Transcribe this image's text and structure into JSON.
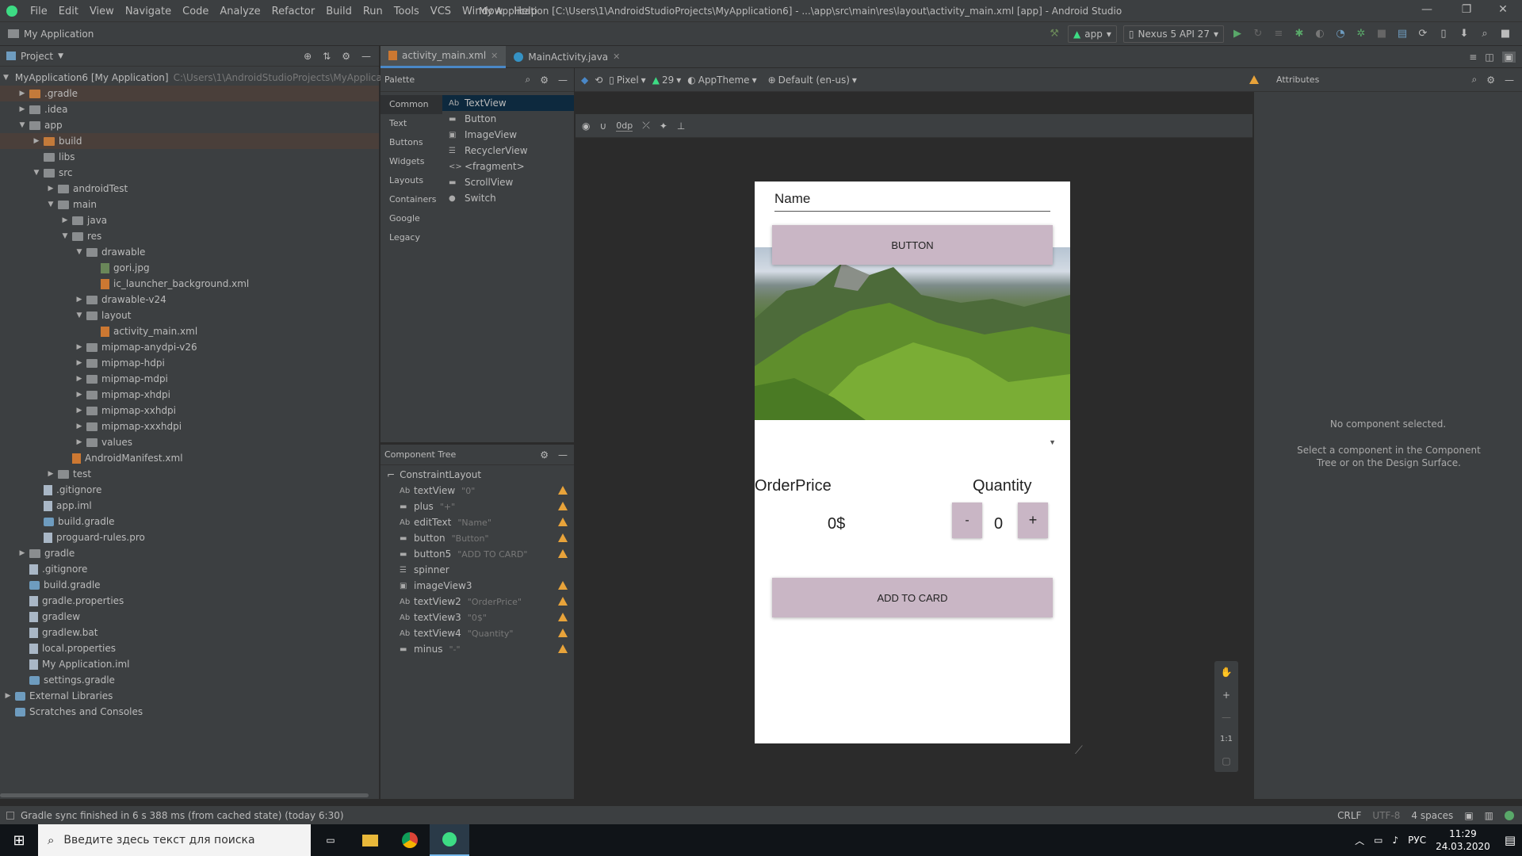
{
  "window": {
    "title": "My Application [C:\\Users\\1\\AndroidStudioProjects\\MyApplication6] - ...\\app\\src\\main\\res\\layout\\activity_main.xml [app] - Android Studio",
    "menu": [
      "File",
      "Edit",
      "View",
      "Navigate",
      "Code",
      "Analyze",
      "Refactor",
      "Build",
      "Run",
      "Tools",
      "VCS",
      "Window",
      "Help"
    ],
    "controls": {
      "minimize": "—",
      "maximize": "❐",
      "close": "✕"
    }
  },
  "navbar": {
    "breadcrumb": "My Application",
    "run_config": "app",
    "device": "Nexus 5 API 27"
  },
  "project": {
    "header": "Project",
    "root_label": "MyApplication6 [My Application]",
    "root_path": "C:\\Users\\1\\AndroidStudioProjects\\MyApplication",
    "items": [
      {
        "label": ".gradle",
        "level": 1,
        "arrow": "▶",
        "icon": "orange",
        "sel": true
      },
      {
        "label": ".idea",
        "level": 1,
        "arrow": "▶",
        "icon": "folder"
      },
      {
        "label": "app",
        "level": 1,
        "arrow": "▼",
        "icon": "folder"
      },
      {
        "label": "build",
        "level": 2,
        "arrow": "▶",
        "icon": "orange",
        "sel": true
      },
      {
        "label": "libs",
        "level": 2,
        "arrow": "",
        "icon": "folder"
      },
      {
        "label": "src",
        "level": 2,
        "arrow": "▼",
        "icon": "folder"
      },
      {
        "label": "androidTest",
        "level": 3,
        "arrow": "▶",
        "icon": "folder"
      },
      {
        "label": "main",
        "level": 3,
        "arrow": "▼",
        "icon": "folder"
      },
      {
        "label": "java",
        "level": 4,
        "arrow": "▶",
        "icon": "folder"
      },
      {
        "label": "res",
        "level": 4,
        "arrow": "▼",
        "icon": "folder"
      },
      {
        "label": "drawable",
        "level": 5,
        "arrow": "▼",
        "icon": "folder"
      },
      {
        "label": "gori.jpg",
        "level": 6,
        "arrow": "",
        "icon": "img"
      },
      {
        "label": "ic_launcher_background.xml",
        "level": 6,
        "arrow": "",
        "icon": "xml"
      },
      {
        "label": "drawable-v24",
        "level": 5,
        "arrow": "▶",
        "icon": "folder"
      },
      {
        "label": "layout",
        "level": 5,
        "arrow": "▼",
        "icon": "folder"
      },
      {
        "label": "activity_main.xml",
        "level": 6,
        "arrow": "",
        "icon": "xml"
      },
      {
        "label": "mipmap-anydpi-v26",
        "level": 5,
        "arrow": "▶",
        "icon": "folder"
      },
      {
        "label": "mipmap-hdpi",
        "level": 5,
        "arrow": "▶",
        "icon": "folder"
      },
      {
        "label": "mipmap-mdpi",
        "level": 5,
        "arrow": "▶",
        "icon": "folder"
      },
      {
        "label": "mipmap-xhdpi",
        "level": 5,
        "arrow": "▶",
        "icon": "folder"
      },
      {
        "label": "mipmap-xxhdpi",
        "level": 5,
        "arrow": "▶",
        "icon": "folder"
      },
      {
        "label": "mipmap-xxxhdpi",
        "level": 5,
        "arrow": "▶",
        "icon": "folder"
      },
      {
        "label": "values",
        "level": 5,
        "arrow": "▶",
        "icon": "folder"
      },
      {
        "label": "AndroidManifest.xml",
        "level": 4,
        "arrow": "",
        "icon": "xml"
      },
      {
        "label": "test",
        "level": 3,
        "arrow": "▶",
        "icon": "folder"
      },
      {
        "label": ".gitignore",
        "level": 2,
        "arrow": "",
        "icon": "file"
      },
      {
        "label": "app.iml",
        "level": 2,
        "arrow": "",
        "icon": "file"
      },
      {
        "label": "build.gradle",
        "level": 2,
        "arrow": "",
        "icon": "gr"
      },
      {
        "label": "proguard-rules.pro",
        "level": 2,
        "arrow": "",
        "icon": "file"
      },
      {
        "label": "gradle",
        "level": 1,
        "arrow": "▶",
        "icon": "folder"
      },
      {
        "label": ".gitignore",
        "level": 1,
        "arrow": "",
        "icon": "file"
      },
      {
        "label": "build.gradle",
        "level": 1,
        "arrow": "",
        "icon": "gr"
      },
      {
        "label": "gradle.properties",
        "level": 1,
        "arrow": "",
        "icon": "file"
      },
      {
        "label": "gradlew",
        "level": 1,
        "arrow": "",
        "icon": "file"
      },
      {
        "label": "gradlew.bat",
        "level": 1,
        "arrow": "",
        "icon": "file"
      },
      {
        "label": "local.properties",
        "level": 1,
        "arrow": "",
        "icon": "file"
      },
      {
        "label": "My Application.iml",
        "level": 1,
        "arrow": "",
        "icon": "file"
      },
      {
        "label": "settings.gradle",
        "level": 1,
        "arrow": "",
        "icon": "gr"
      },
      {
        "label": "External Libraries",
        "level": 0,
        "arrow": "▶",
        "icon": "lib"
      },
      {
        "label": "Scratches and Consoles",
        "level": 0,
        "arrow": "",
        "icon": "scratch"
      }
    ]
  },
  "tabs": [
    {
      "label": "activity_main.xml",
      "active": true
    },
    {
      "label": "MainActivity.java",
      "active": false
    }
  ],
  "design_toolbar": {
    "device": "Pixel",
    "api": "29",
    "theme": "AppTheme",
    "locale": "Default (en-us)",
    "margin": "0dp"
  },
  "palette": {
    "title": "Palette",
    "categories": [
      "Common",
      "Text",
      "Buttons",
      "Widgets",
      "Layouts",
      "Containers",
      "Google",
      "Legacy"
    ],
    "items": [
      {
        "prefix": "Ab",
        "label": "TextView"
      },
      {
        "prefix": "▬",
        "label": "Button"
      },
      {
        "prefix": "▣",
        "label": "ImageView"
      },
      {
        "prefix": "☰",
        "label": "RecyclerView"
      },
      {
        "prefix": "<>",
        "label": "<fragment>"
      },
      {
        "prefix": "▬",
        "label": "ScrollView"
      },
      {
        "prefix": "●",
        "label": "Switch"
      }
    ]
  },
  "component_tree": {
    "title": "Component Tree",
    "root": "ConstraintLayout",
    "items": [
      {
        "prefix": "Ab",
        "id": "textView",
        "hint": "\"0\"",
        "warn": true
      },
      {
        "prefix": "▬",
        "id": "plus",
        "hint": "\"+\"",
        "warn": true
      },
      {
        "prefix": "Ab",
        "id": "editText",
        "hint": "\"Name\"",
        "warn": true
      },
      {
        "prefix": "▬",
        "id": "button",
        "hint": "\"Button\"",
        "warn": true
      },
      {
        "prefix": "▬",
        "id": "button5",
        "hint": "\"ADD TO CARD\"",
        "warn": true
      },
      {
        "prefix": "☰",
        "id": "spinner",
        "hint": "",
        "warn": false
      },
      {
        "prefix": "▣",
        "id": "imageView3",
        "hint": "",
        "warn": true
      },
      {
        "prefix": "Ab",
        "id": "textView2",
        "hint": "\"OrderPrice\"",
        "warn": true
      },
      {
        "prefix": "Ab",
        "id": "textView3",
        "hint": "\"0$\"",
        "warn": true
      },
      {
        "prefix": "Ab",
        "id": "textView4",
        "hint": "\"Quantity\"",
        "warn": true
      },
      {
        "prefix": "▬",
        "id": "minus",
        "hint": "\"-\"",
        "warn": true
      }
    ]
  },
  "phone": {
    "name_field": "Name",
    "button": "BUTTON",
    "order_price_label": "OrderPrice",
    "quantity_label": "Quantity",
    "price_value": "0$",
    "minus": "-",
    "quantity_value": "0",
    "plus": "+",
    "add_to_card": "ADD TO CARD"
  },
  "attributes": {
    "title": "Attributes",
    "empty_title": "No component selected.",
    "empty_desc": "Select a component in the Component Tree or on the Design Surface."
  },
  "zoom": {
    "ratio": "1:1"
  },
  "status": {
    "message": "Gradle sync finished in 6 s 388 ms (from cached state) (today 6:30)",
    "line_sep": "CRLF",
    "encoding": "UTF-8",
    "indent": "4 spaces"
  },
  "taskbar": {
    "search_placeholder": "Введите здесь текст для поиска",
    "lang": "РУС",
    "time": "11:29",
    "date": "24.03.2020"
  },
  "colors": {
    "accent": "#4a88c7",
    "button_bg": "#c9b6c5",
    "warn": "#e8a33a"
  }
}
